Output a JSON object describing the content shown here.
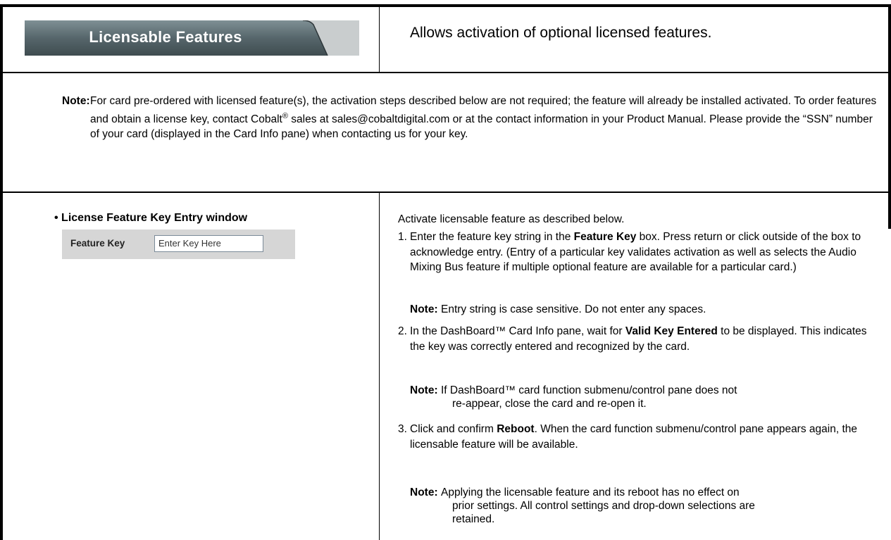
{
  "header": {
    "tab_label": "Licensable Features",
    "description": "Allows activation of optional licensed features."
  },
  "note_top": {
    "label": "Note:",
    "text_part1": "For card pre-ordered with licensed feature(s), the activation steps described below are not required; the feature will already be installed activated. To order features and obtain a license key, contact Cobalt",
    "registered_mark": "®",
    "text_part2": " sales at sales@cobaltdigital.com or at the contact information in your Product Manual. Please provide the “SSN” number of your card (displayed in the Card Info pane) when contacting us for your key."
  },
  "section": {
    "title": "• License Feature Key Entry window",
    "feature_key_label": "Feature Key",
    "feature_key_value": "Enter Key Here"
  },
  "right": {
    "intro": "Activate licensable feature as described below.",
    "step1": {
      "num": "1.",
      "a": "Enter the feature key string in the ",
      "b": "Feature Key",
      "c": " box. Press return or click outside of the box to acknowledge entry. (Entry of a particular key validates activation as well as selects the Audio Mixing Bus feature if multiple optional feature are available for a particular card.)"
    },
    "note1": {
      "label": "Note:",
      "text": "Entry string is case sensitive. Do not enter any spaces."
    },
    "step2": {
      "num": "2.",
      "a": "In the DashBoard™ Card Info pane, wait for ",
      "b": "Valid Key Entered",
      "c": " to be displayed. This indicates the key was correctly entered and recognized by the card."
    },
    "note2": {
      "label": "Note:",
      "line1": "If DashBoard™ card function submenu/control pane does not",
      "line2": "re-appear, close the card and re-open it."
    },
    "step3": {
      "num": "3.",
      "a": "Click and confirm ",
      "b": "Reboot",
      "c": ". When the card function submenu/control pane appears again, the licensable feature will be available."
    },
    "note3": {
      "label": "Note:",
      "line1": "Applying the licensable feature and its reboot has no effect on",
      "line2": "prior settings. All control settings and drop-down selections are",
      "line3": "retained."
    }
  }
}
